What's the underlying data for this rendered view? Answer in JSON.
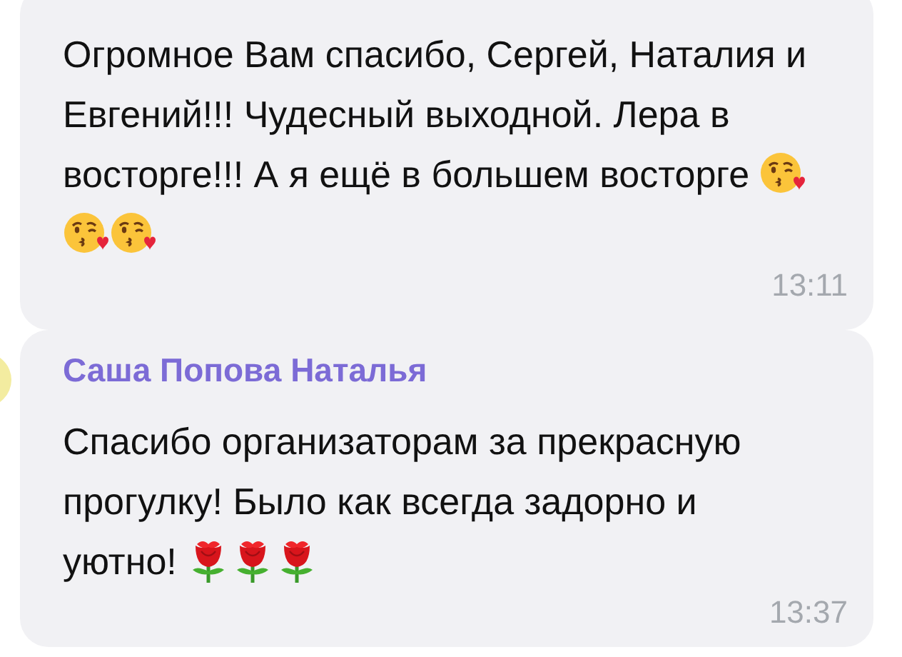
{
  "messages": [
    {
      "text": "Огромное Вам спасибо, Сергей, Наталия и Евгений!!! Чудесный выходной. Лера в восторге!!! А я ещё в большем восторге",
      "emojis": [
        {
          "kind": "kiss"
        },
        {
          "kind": "kiss"
        },
        {
          "kind": "kiss"
        }
      ],
      "time": "13:11",
      "avatar": false
    },
    {
      "sender": "Саша Попова Наталья",
      "text": "Спасибо организаторам за прекрасную прогулку! Было как всегда задорно и уютно!",
      "emojis": [
        {
          "kind": "rose"
        },
        {
          "kind": "rose"
        },
        {
          "kind": "rose"
        }
      ],
      "time": "13:37",
      "avatar": true
    }
  ]
}
